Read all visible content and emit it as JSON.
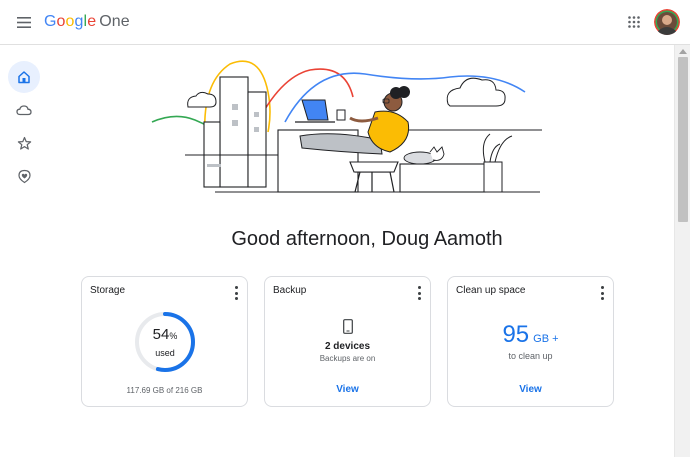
{
  "header": {
    "logo": {
      "letters": [
        "G",
        "o",
        "o",
        "g",
        "l",
        "e"
      ],
      "product": "One"
    },
    "menu_icon": "hamburger-menu-icon",
    "apps_icon": "apps-grid-icon"
  },
  "sidebar": {
    "items": [
      {
        "icon": "home-icon",
        "active": true
      },
      {
        "icon": "cloud-icon",
        "active": false
      },
      {
        "icon": "star-icon",
        "active": false
      },
      {
        "icon": "support-heart-icon",
        "active": false
      }
    ]
  },
  "greeting": "Good afternoon, Doug Aamoth",
  "cards": {
    "storage": {
      "title": "Storage",
      "percent": "54",
      "percent_sign": "%",
      "used_label": "used",
      "usage_text": "117.69 GB of 216 GB",
      "usage_fraction": 0.54
    },
    "backup": {
      "title": "Backup",
      "devices": "2 devices",
      "status": "Backups are on",
      "link": "View"
    },
    "cleanup": {
      "title": "Clean up space",
      "amount": "95",
      "unit": "GB +",
      "sub": "to clean up",
      "link": "View"
    }
  },
  "colors": {
    "accent": "#1a73e8",
    "ring_track": "#e8eaed",
    "google_blue": "#4285f4",
    "google_red": "#ea4335",
    "google_yellow": "#fbbc04",
    "google_green": "#34a853"
  }
}
